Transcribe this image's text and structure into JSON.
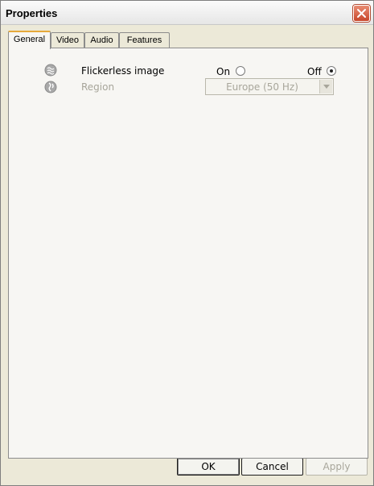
{
  "window": {
    "title": "Properties",
    "close_icon": "close-icon"
  },
  "tabs": [
    {
      "label": "General",
      "active": true
    },
    {
      "label": "Video",
      "active": false
    },
    {
      "label": "Audio",
      "active": false
    },
    {
      "label": "Features",
      "active": false
    }
  ],
  "general": {
    "flickerless": {
      "label": "Flickerless image",
      "icon": "flicker-icon",
      "on_label": "On",
      "off_label": "Off",
      "selected": "Off"
    },
    "region": {
      "label": "Region",
      "icon": "globe-icon",
      "value": "Europe (50 Hz)",
      "enabled": false
    }
  },
  "buttons": {
    "ok": "OK",
    "cancel": "Cancel",
    "apply": "Apply"
  }
}
